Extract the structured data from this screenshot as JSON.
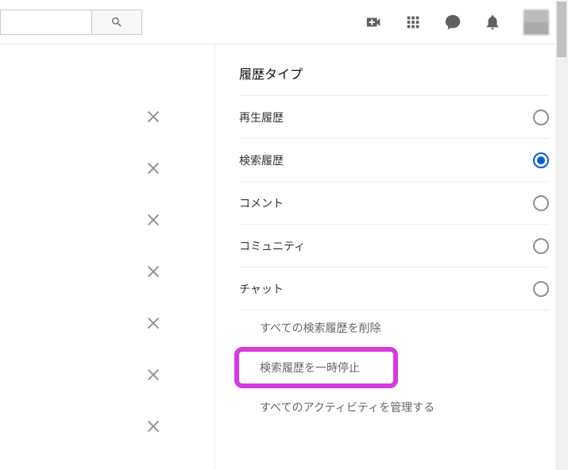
{
  "header": {
    "search_placeholder": "",
    "icons": [
      "video-add-icon",
      "apps-icon",
      "chat-icon",
      "bell-icon"
    ]
  },
  "remove_buttons_count": 7,
  "sidebar": {
    "title": "履歴タイプ",
    "options": [
      {
        "label": "再生履歴",
        "selected": false
      },
      {
        "label": "検索履歴",
        "selected": true
      },
      {
        "label": "コメント",
        "selected": false
      },
      {
        "label": "コミュニティ",
        "selected": false
      },
      {
        "label": "チャット",
        "selected": false
      }
    ],
    "links": {
      "clear_all": "すべての検索履歴を削除",
      "pause": "検索履歴を一時停止",
      "manage": "すべてのアクティビティを管理する"
    }
  },
  "highlight_link_key": "pause"
}
